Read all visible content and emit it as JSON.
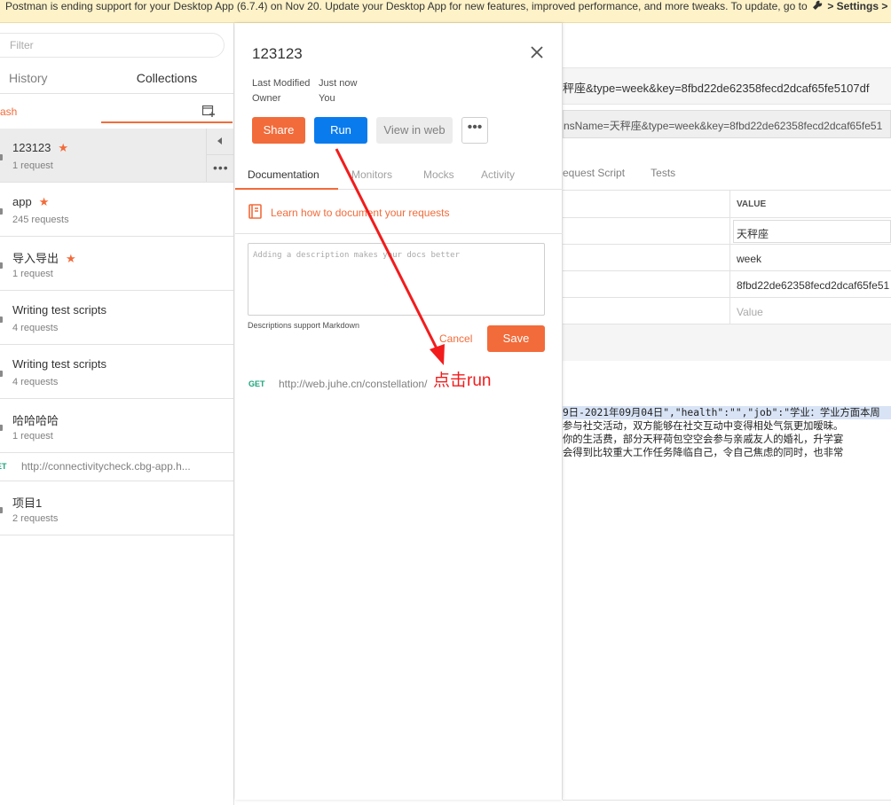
{
  "banner": {
    "text": "Postman is ending support for your Desktop App (6.7.4) on Nov 20. Update your Desktop App for new features, improved performance, and more tweaks. To update, go to",
    "settings_text": " > Settings > "
  },
  "sidebar": {
    "filter_placeholder": "Filter",
    "tabs": {
      "history": "History",
      "collections": "Collections"
    },
    "trash_label": "ash",
    "collections": [
      {
        "name": "123123",
        "starred": true,
        "count": "1 request"
      },
      {
        "name": "app",
        "starred": true,
        "count": "245 requests"
      },
      {
        "name": "导入导出",
        "starred": true,
        "count": "1 request"
      },
      {
        "name": "Writing test scripts",
        "starred": false,
        "count": "4 requests"
      },
      {
        "name": "Writing test scripts",
        "starred": false,
        "count": "4 requests"
      },
      {
        "name": "哈哈哈哈",
        "starred": false,
        "count": "1 request"
      },
      {
        "name": "项目1",
        "starred": false,
        "count": "2 requests"
      }
    ],
    "request_row": {
      "method": "ET",
      "url": "http://connectivitycheck.cbg-app.h..."
    },
    "star_glyph": "★",
    "more_glyph": "•••"
  },
  "builder": {
    "url_title": "秤座&type=week&key=8fbd22de62358fecd2dcaf65fe5107df",
    "url_input": "nsName=天秤座&type=week&key=8fbd22de62358fecd2dcaf65fe51",
    "tabs": [
      "equest Script",
      "Tests"
    ],
    "params_header": "VALUE",
    "params": [
      "天秤座",
      "week",
      "8fbd22de62358fecd2dcaf65fe51"
    ],
    "params_placeholder": "Value",
    "response_lines": [
      "9日-2021年09月04日\",\"health\":\"\",\"job\":\"学业：学业方面本周",
      "参与社交活动，双方能够在社交互动中变得相处气氛更加暧昧。",
      "你的生活费，部分天秤荷包空空会参与亲戚友人的婚礼，升学宴",
      "会得到比较重大工作任务降临自己，令自己焦虑的同时，也非常"
    ]
  },
  "panel": {
    "title": "123123",
    "last_modified_label": "Last Modified",
    "last_modified_value": "Just now",
    "owner_label": "Owner",
    "owner_value": "You",
    "share": "Share",
    "run": "Run",
    "view_web": "View in web",
    "tabs": {
      "documentation": "Documentation",
      "monitors": "Monitors",
      "mocks": "Mocks",
      "activity": "Activity"
    },
    "learn_link": "Learn how to document your requests",
    "desc_placeholder": "Adding a description makes your docs better",
    "markdown_hint": "Descriptions support Markdown",
    "cancel": "Cancel",
    "save": "Save",
    "request": {
      "method": "GET",
      "url": "http://web.juhe.cn/constellation/"
    }
  },
  "annotation": {
    "text": "点击run",
    "color": "#f21c1c"
  },
  "colors": {
    "accent": "#f26b3a",
    "run": "#097bed",
    "method_get": "#1aa37a"
  }
}
